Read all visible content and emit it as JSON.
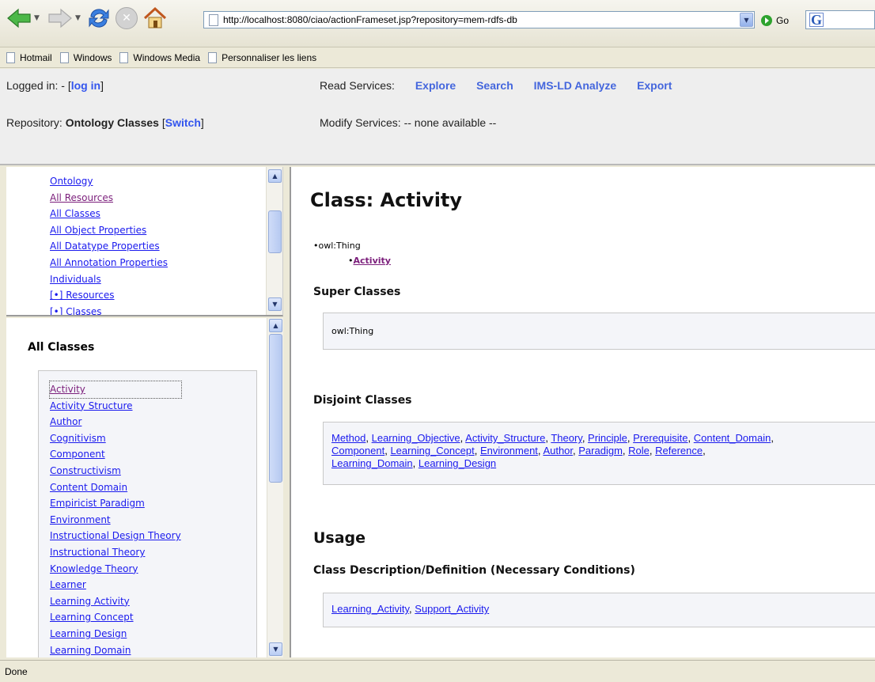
{
  "browser": {
    "url": "http://localhost:8080/ciao/actionFrameset.jsp?repository=mem-rdfs-db",
    "go_label": "Go",
    "links_bar": [
      "Hotmail",
      "Windows",
      "Windows Media",
      "Personnaliser les liens"
    ],
    "status": "Done"
  },
  "header": {
    "logged_in_label": "Logged in: - ",
    "login_link": "log in",
    "repository_label": "Repository: ",
    "repository_name": "Ontology Classes",
    "switch_link": "Switch",
    "read_services_label": "Read Services:",
    "read_services": [
      "Explore",
      "Search",
      "IMS-LD Analyze",
      "Export"
    ],
    "modify_services_label": "Modify Services:",
    "modify_services_value": " -- none available --"
  },
  "nav": {
    "links": [
      "Ontology",
      "All Resources",
      "All Classes",
      "All Object Properties",
      "All Datatype Properties",
      "All Annotation Properties",
      "Individuals",
      "[•] Resources",
      "[•] Classes"
    ]
  },
  "classes": {
    "title": "All Classes",
    "items": [
      "Activity",
      "Activity Structure",
      "Author",
      "Cognitivism",
      "Component",
      "Constructivism",
      "Content Domain",
      "Empiricist Paradigm",
      "Environment",
      "Instructional Design Theory",
      "Instructional Theory",
      "Knowledge Theory",
      "Learner",
      "Learning Activity",
      "Learning Concept",
      "Learning Design",
      "Learning Domain"
    ]
  },
  "main": {
    "title": "Class: Activity",
    "hierarchy_root": "owl:Thing",
    "hierarchy_child": "Activity",
    "super_classes_heading": "Super Classes",
    "super_classes_value": "owl:Thing",
    "disjoint_heading": "Disjoint Classes",
    "disjoint_line1": [
      "Method",
      "Learning_Objective",
      "Activity_Structure",
      "Theory",
      "Principle",
      "Prerequisite",
      "Content_Domain"
    ],
    "disjoint_line2": [
      "Component",
      "Learning_Concept",
      "Environment",
      "Author",
      "Paradigm",
      "Role",
      "Reference"
    ],
    "disjoint_line3": [
      "Learning_Domain",
      "Learning_Design"
    ],
    "usage_heading": "Usage",
    "definition_heading": "Class Description/Definition (Necessary Conditions)",
    "definition_items": [
      "Learning_Activity",
      "Support_Activity"
    ]
  }
}
